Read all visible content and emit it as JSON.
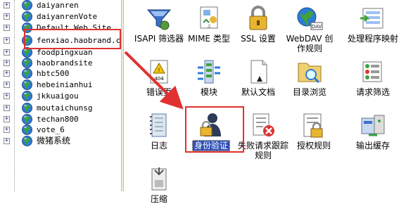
{
  "tree": {
    "items": [
      {
        "label": "daiyanren",
        "cjk": false
      },
      {
        "label": "daiyanrenVote",
        "cjk": false
      },
      {
        "label": "Default Web Site",
        "cjk": false
      },
      {
        "label": "fenxiao.haobrand.cn",
        "cjk": false
      },
      {
        "label": "foodpingxuan",
        "cjk": false
      },
      {
        "label": "haobrandsite",
        "cjk": false
      },
      {
        "label": "hbtc500",
        "cjk": false
      },
      {
        "label": "hebeinianhui",
        "cjk": false
      },
      {
        "label": "jkkuaigou",
        "cjk": false
      },
      {
        "label": "moutaichunsg",
        "cjk": false
      },
      {
        "label": "techan800",
        "cjk": false
      },
      {
        "label": "vote_6",
        "cjk": false
      },
      {
        "label": "微猪系统",
        "cjk": true
      }
    ]
  },
  "features": {
    "isapi": "ISAPI 筛选器",
    "mime": "MIME 类型",
    "ssl": "SSL 设置",
    "webdav": "WebDAV 创作规则",
    "handler": "处理程序映射",
    "errorpages": "错误页",
    "modules": "模块",
    "defaultdoc": "默认文档",
    "dirbrowse": "目录浏览",
    "reqfilter": "请求筛选",
    "logging": "日志",
    "auth": "身份验证",
    "failedreq": "失败请求跟踪规则",
    "authz": "授权规则",
    "outputcache": "输出缓存",
    "compress": "压缩"
  },
  "icon_badges": {
    "webdav_badge": "DAV",
    "error_badge": "404"
  },
  "colors": {
    "highlight_red": "#e03030",
    "selection_blue": "#2f50b4"
  }
}
